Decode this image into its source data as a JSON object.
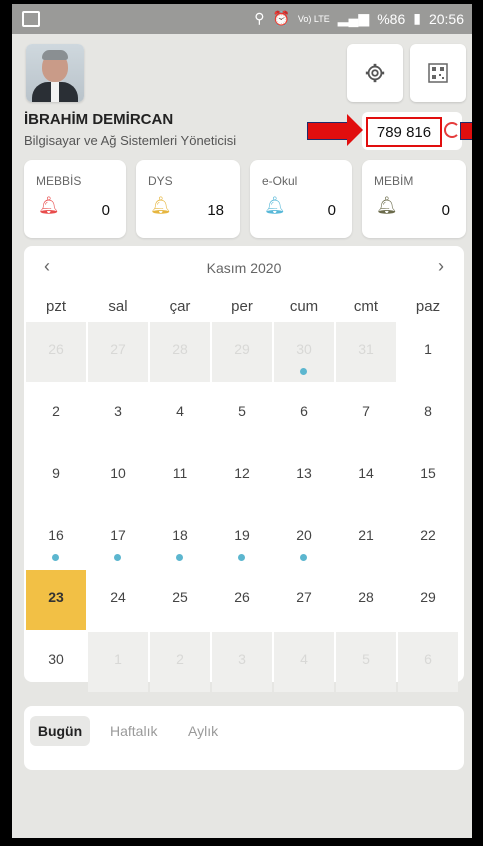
{
  "status_bar": {
    "battery_text": "%86",
    "time": "20:56",
    "network_text": "Vo) LTE"
  },
  "profile": {
    "name": "İBRAHİM DEMİRCAN",
    "role": "Bilgisayar ve Ağ Sistemleri Yöneticisi",
    "counter": "789 816"
  },
  "icons": {
    "settings": "gear-icon",
    "qr": "qr-code-icon"
  },
  "notifications": [
    {
      "label": "MEBBİS",
      "count": "0",
      "bell_color": "#e84c4c"
    },
    {
      "label": "DYS",
      "count": "18",
      "bell_color": "#e6b640"
    },
    {
      "label": "e-Okul",
      "count": "0",
      "bell_color": "#58b8d8"
    },
    {
      "label": "MEBİM",
      "count": "0",
      "bell_color": "#6b6b4b"
    }
  ],
  "calendar": {
    "month_title": "Kasım 2020",
    "prev": "‹",
    "next": "›",
    "weekdays": [
      "pzt",
      "sal",
      "çar",
      "per",
      "cum",
      "cmt",
      "paz"
    ],
    "rows": [
      [
        {
          "d": "26",
          "m": true
        },
        {
          "d": "27",
          "m": true
        },
        {
          "d": "28",
          "m": true
        },
        {
          "d": "29",
          "m": true
        },
        {
          "d": "30",
          "m": true,
          "dot": true
        },
        {
          "d": "31",
          "m": true
        },
        {
          "d": "1"
        }
      ],
      [
        {
          "d": "2"
        },
        {
          "d": "3"
        },
        {
          "d": "4"
        },
        {
          "d": "5"
        },
        {
          "d": "6"
        },
        {
          "d": "7"
        },
        {
          "d": "8"
        }
      ],
      [
        {
          "d": "9"
        },
        {
          "d": "10"
        },
        {
          "d": "11"
        },
        {
          "d": "12"
        },
        {
          "d": "13"
        },
        {
          "d": "14"
        },
        {
          "d": "15"
        }
      ],
      [
        {
          "d": "16",
          "dot": true
        },
        {
          "d": "17",
          "dot": true
        },
        {
          "d": "18",
          "dot": true
        },
        {
          "d": "19",
          "dot": true
        },
        {
          "d": "20",
          "dot": true
        },
        {
          "d": "21"
        },
        {
          "d": "22"
        }
      ],
      [
        {
          "d": "23",
          "today": true
        },
        {
          "d": "24"
        },
        {
          "d": "25"
        },
        {
          "d": "26"
        },
        {
          "d": "27"
        },
        {
          "d": "28"
        },
        {
          "d": "29"
        }
      ],
      [
        {
          "d": "30"
        },
        {
          "d": "1",
          "m": true
        },
        {
          "d": "2",
          "m": true
        },
        {
          "d": "3",
          "m": true
        },
        {
          "d": "4",
          "m": true
        },
        {
          "d": "5",
          "m": true
        },
        {
          "d": "6",
          "m": true
        }
      ]
    ]
  },
  "filters": {
    "today": "Bugün",
    "weekly": "Haftalık",
    "monthly": "Aylık"
  },
  "colors": {
    "accent_today": "#f2c045",
    "event_dot": "#5cb6cf",
    "highlight_red": "#e10e0e"
  }
}
